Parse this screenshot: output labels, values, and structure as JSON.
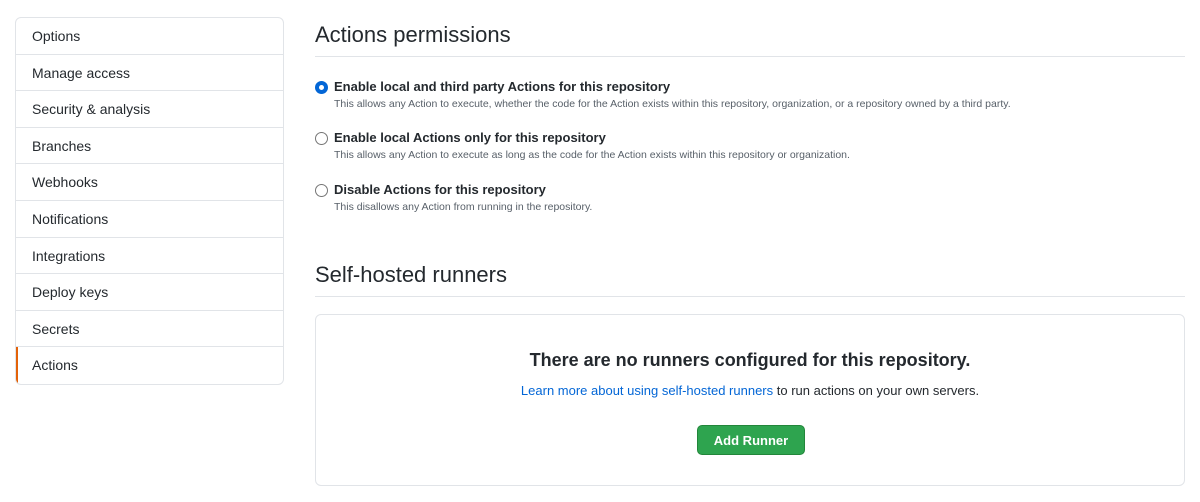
{
  "sidebar": {
    "items": [
      {
        "label": "Options"
      },
      {
        "label": "Manage access"
      },
      {
        "label": "Security & analysis"
      },
      {
        "label": "Branches"
      },
      {
        "label": "Webhooks"
      },
      {
        "label": "Notifications"
      },
      {
        "label": "Integrations"
      },
      {
        "label": "Deploy keys"
      },
      {
        "label": "Secrets"
      },
      {
        "label": "Actions"
      }
    ],
    "selected": "Actions",
    "selected_accent_color": "#e36209"
  },
  "permissions": {
    "title": "Actions permissions",
    "options": [
      {
        "label": "Enable local and third party Actions for this repository",
        "note": "This allows any Action to execute, whether the code for the Action exists within this repository, organization, or a repository owned by a third party.",
        "checked": true
      },
      {
        "label": "Enable local Actions only for this repository",
        "note": "This allows any Action to execute as long as the code for the Action exists within this repository or organization.",
        "checked": false
      },
      {
        "label": "Disable Actions for this repository",
        "note": "This disallows any Action from running in the repository.",
        "checked": false
      }
    ]
  },
  "runners": {
    "title": "Self-hosted runners",
    "empty_heading": "There are no runners configured for this repository.",
    "link_text": "Learn more about using self-hosted runners",
    "suffix_text": " to run actions on your own servers.",
    "button_label": "Add Runner"
  },
  "colors": {
    "link": "#0366d6",
    "primary_button": "#2ea44f",
    "border": "#e1e4e8"
  }
}
